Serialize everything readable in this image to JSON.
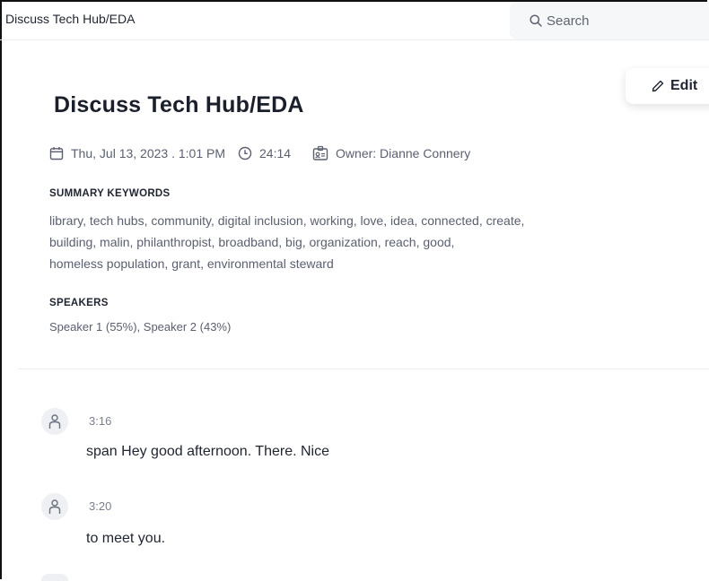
{
  "window": {
    "title": "Discuss Tech Hub/EDA"
  },
  "search": {
    "label": "Search",
    "icon": "search-icon"
  },
  "toolbar": {
    "edit_label": "Edit",
    "edit_icon": "pencil-icon"
  },
  "meeting": {
    "title": "Discuss Tech Hub/EDA",
    "date": "Thu, Jul 13, 2023 . 1:01 PM",
    "duration": "24:14",
    "owner": "Owner: Dianne Connery"
  },
  "summary": {
    "keywords_label": "SUMMARY KEYWORDS",
    "keywords_line1": "library, tech hubs, community, digital inclusion, working, love, idea, connected, create,",
    "keywords_line2": "building, malin, philanthropist, broadband, big, organization, reach, good,",
    "keywords_line3": "homeless population, grant, environmental steward",
    "speakers_label": "SPEAKERS",
    "speakers": "Speaker 1 (55%), Speaker 2 (43%)"
  },
  "transcript": [
    {
      "time": "3:16",
      "text": "span Hey good afternoon. There. Nice"
    },
    {
      "time": "3:20",
      "text": "to meet you."
    }
  ],
  "colors": {
    "text": "#1f2430",
    "muted": "#5b6070",
    "search_bg": "#f6f7f9"
  }
}
